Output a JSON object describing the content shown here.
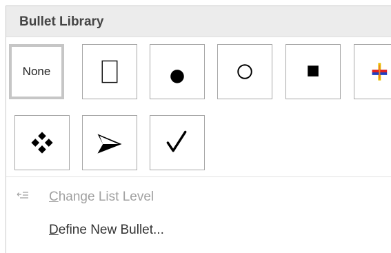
{
  "bullet_library": {
    "title": "Bullet Library",
    "tiles": [
      {
        "name": "none",
        "label": "None",
        "selected": true
      },
      {
        "name": "empty-square",
        "icon": "empty-rectangle-icon"
      },
      {
        "name": "filled-circle",
        "icon": "filled-circle-icon"
      },
      {
        "name": "hollow-circle",
        "icon": "hollow-circle-icon"
      },
      {
        "name": "filled-square",
        "icon": "filled-square-icon"
      },
      {
        "name": "colorful-cross",
        "icon": "colorful-cross-icon"
      },
      {
        "name": "four-diamonds",
        "icon": "four-diamonds-icon"
      },
      {
        "name": "arrowhead",
        "icon": "arrowhead-icon"
      },
      {
        "name": "checkmark",
        "icon": "checkmark-icon"
      }
    ]
  },
  "menu": {
    "change_list_level": {
      "accel": "C",
      "rest": "hange List Level",
      "enabled": false,
      "icon": "change-list-level-icon"
    },
    "define_new_bullet": {
      "accel": "D",
      "rest": "efine New Bullet...",
      "enabled": true
    }
  },
  "colors": {
    "header_bg": "#ececec",
    "tile_border": "#a6a6a6",
    "selected_border": "#c6c6c6",
    "disabled_text": "#a0a0a0",
    "enabled_text": "#333333"
  }
}
